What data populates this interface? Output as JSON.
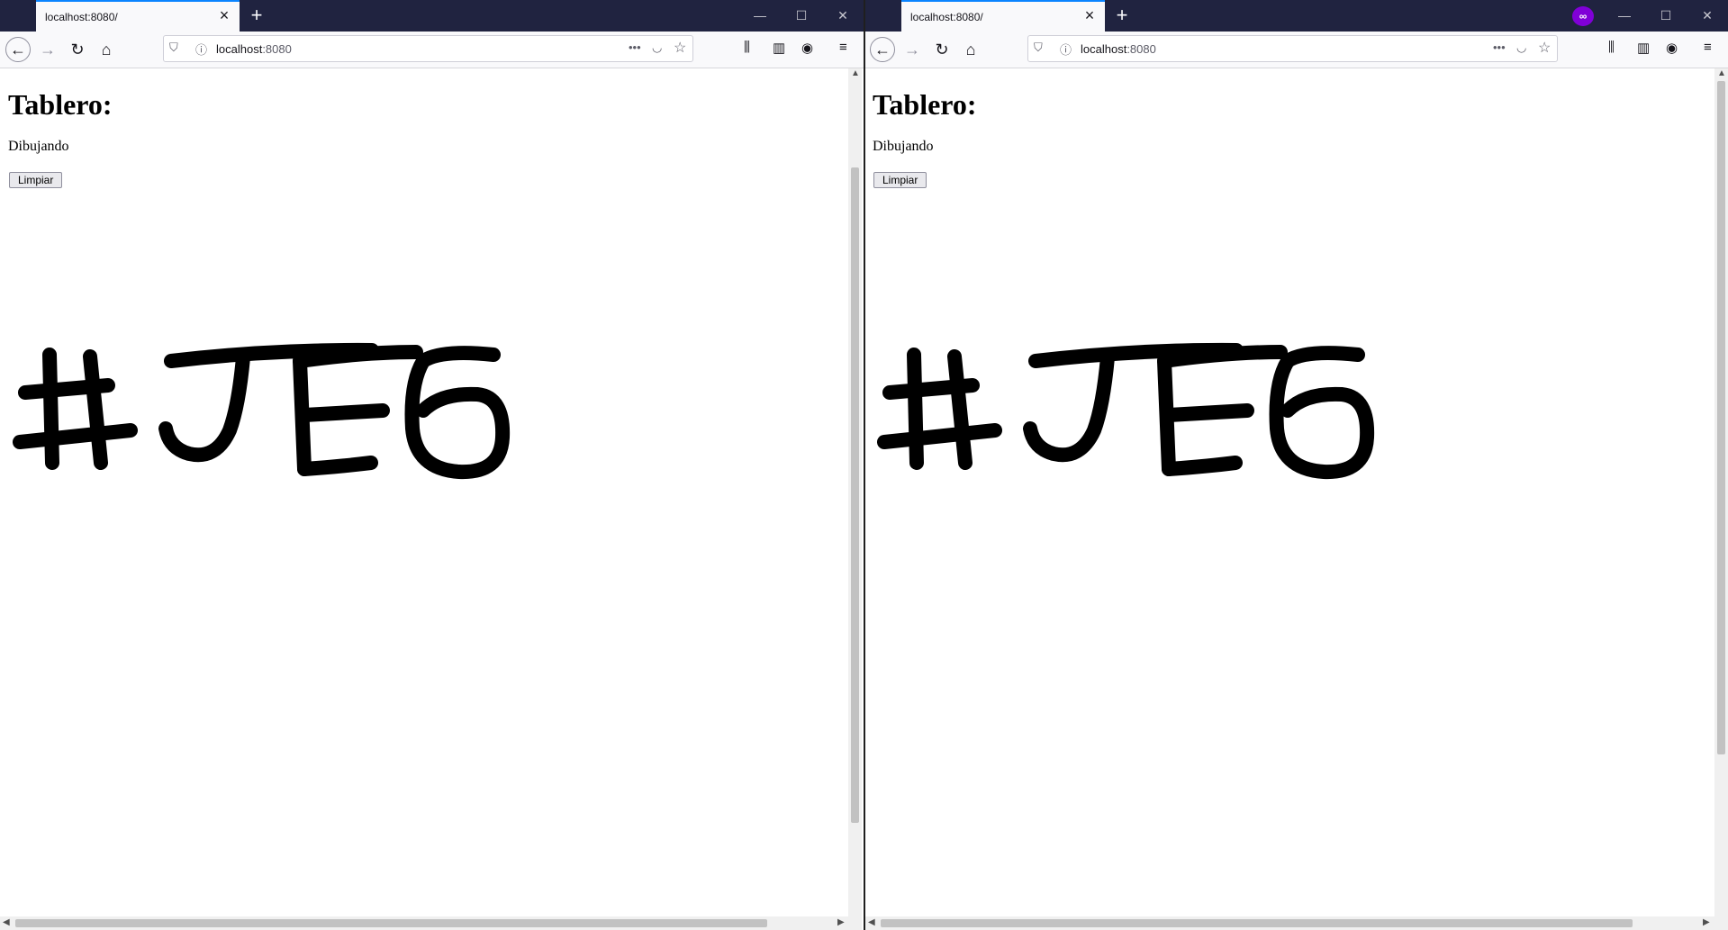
{
  "windows": [
    {
      "tab_title": "localhost:8080/",
      "url_host": "localhost",
      "url_port": ":8080",
      "page": {
        "heading": "Tablero:",
        "status": "Dibujando",
        "clear_button": "Limpiar",
        "drawing_text": "#JE6"
      },
      "private": false
    },
    {
      "tab_title": "localhost:8080/",
      "url_host": "localhost",
      "url_port": ":8080",
      "page": {
        "heading": "Tablero:",
        "status": "Dibujando",
        "clear_button": "Limpiar",
        "drawing_text": "#JE6"
      },
      "private": true
    }
  ],
  "icons": {
    "close": "close-icon",
    "new_tab": "plus-icon",
    "back": "arrow-left-icon",
    "forward": "arrow-right-icon",
    "reload": "reload-icon",
    "home": "home-icon",
    "shield": "shield-icon",
    "info": "info-icon",
    "more": "more-icon",
    "pocket": "pocket-icon",
    "bookmark": "star-icon",
    "library": "library-icon",
    "sidebar": "sidebar-icon",
    "account": "account-icon",
    "menu": "hamburger-menu-icon",
    "private": "private-browsing-icon"
  },
  "colors": {
    "tabbar": "#202340",
    "accent": "#0a84ff",
    "private_badge": "#8000d7",
    "ink": "#000000"
  }
}
